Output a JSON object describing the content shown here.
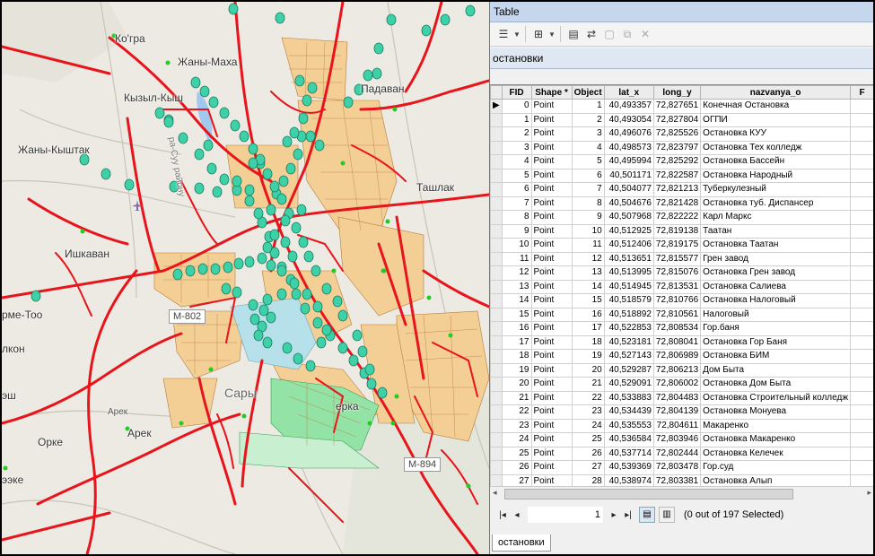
{
  "map": {
    "place_labels": [
      "Ко'гра",
      "Жаны-Маха",
      "Кызыл-Кыш",
      "Жаны-Кыштак",
      "Падаван",
      "Ташлак",
      "Ишкаван",
      "рме-Тоо",
      "лкон",
      "эш",
      "Арек",
      "Орке",
      "Арек",
      "Сары",
      "ерка",
      "ээке"
    ],
    "rotated_label": "ра-Суу району",
    "road_shields": [
      "М-802",
      "М-894"
    ],
    "colors": {
      "roads": "#e8141c",
      "stops": "#3ed1a8",
      "urban_fill": "#f3cf96",
      "urban_streets": "#b87c3a",
      "green_zone": "#93e3a6",
      "blue_zone": "#b6e1ea",
      "water": "#a3c8ef"
    }
  },
  "table_window": {
    "title": "Table",
    "table_name": "остановки",
    "toolbar_icons": [
      "table-options-icon",
      "related-tables-icon",
      "select-by-attributes-icon",
      "switch-selection-icon",
      "clear-selection-icon",
      "zoom-selected-icon",
      "delete-selected-icon"
    ],
    "columns": [
      "FID",
      "Shape *",
      "Object",
      "lat_x",
      "long_y",
      "nazvanya_o",
      "F"
    ],
    "rows": [
      [
        "0",
        "Point",
        "1",
        "40,493357",
        "72,827651",
        "Конечная Остановка"
      ],
      [
        "1",
        "Point",
        "2",
        "40,493054",
        "72,827804",
        "ОГПИ"
      ],
      [
        "2",
        "Point",
        "3",
        "40,496076",
        "72,825526",
        "Остановка КУУ"
      ],
      [
        "3",
        "Point",
        "4",
        "40,498573",
        "72,823797",
        "Остановка Тех колледж"
      ],
      [
        "4",
        "Point",
        "5",
        "40,495994",
        "72,825292",
        "Остановка Бассейн"
      ],
      [
        "5",
        "Point",
        "6",
        "40,501171",
        "72,822587",
        "Остановка Народный"
      ],
      [
        "6",
        "Point",
        "7",
        "40,504077",
        "72,821213",
        "Туберкулезный"
      ],
      [
        "7",
        "Point",
        "8",
        "40,504676",
        "72,821428",
        "Остановка туб. Диспансер"
      ],
      [
        "8",
        "Point",
        "9",
        "40,507968",
        "72,822222",
        "Карл Маркс"
      ],
      [
        "9",
        "Point",
        "10",
        "40,512925",
        "72,819138",
        "Таатан"
      ],
      [
        "10",
        "Point",
        "11",
        "40,512406",
        "72,819175",
        "Остановка Таатан"
      ],
      [
        "11",
        "Point",
        "12",
        "40,513651",
        "72,815577",
        "Грен завод"
      ],
      [
        "12",
        "Point",
        "13",
        "40,513995",
        "72,815076",
        "Остановка Грен завод"
      ],
      [
        "13",
        "Point",
        "14",
        "40,514945",
        "72,813531",
        "Остановка Салиева"
      ],
      [
        "14",
        "Point",
        "15",
        "40,518579",
        "72,810766",
        "Остановка Налоговый"
      ],
      [
        "15",
        "Point",
        "16",
        "40,518892",
        "72,810561",
        "Налоговый"
      ],
      [
        "16",
        "Point",
        "17",
        "40,522853",
        "72,808534",
        "Гор.баня"
      ],
      [
        "17",
        "Point",
        "18",
        "40,523181",
        "72,808041",
        "Остановка Гор Баня"
      ],
      [
        "18",
        "Point",
        "19",
        "40,527143",
        "72,806989",
        "Остановка БИМ"
      ],
      [
        "19",
        "Point",
        "20",
        "40,529287",
        "72,806213",
        "Дом Быта"
      ],
      [
        "20",
        "Point",
        "21",
        "40,529091",
        "72,806002",
        "Остановка Дом Быта"
      ],
      [
        "21",
        "Point",
        "22",
        "40,533883",
        "72,804483",
        "Остановка Строительный колледж"
      ],
      [
        "22",
        "Point",
        "23",
        "40,534439",
        "72,804139",
        "Остановка Монуева"
      ],
      [
        "23",
        "Point",
        "24",
        "40,535553",
        "72,804611",
        "Макаренко"
      ],
      [
        "24",
        "Point",
        "25",
        "40,536584",
        "72,803946",
        "Остановка Макаренко"
      ],
      [
        "25",
        "Point",
        "26",
        "40,537714",
        "72,802444",
        "Остановка Келечек"
      ],
      [
        "26",
        "Point",
        "27",
        "40,539369",
        "72,803478",
        "Гор.суд"
      ],
      [
        "27",
        "Point",
        "28",
        "40,538974",
        "72,803381",
        "Остановка Алып"
      ]
    ],
    "navigator": {
      "record": "1",
      "selection_text": "(0 out of 197 Selected)"
    },
    "bottom_tab": "остановки"
  }
}
